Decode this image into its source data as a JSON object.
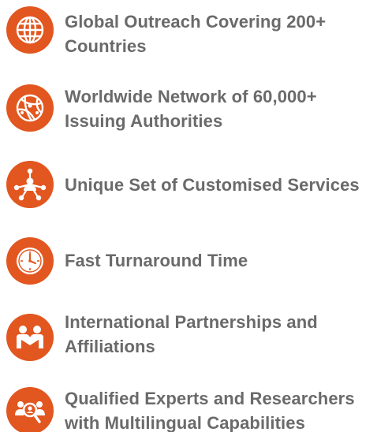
{
  "features": [
    {
      "icon": "globe-icon",
      "lines": [
        "Global Outreach Covering 200+",
        "Countries"
      ]
    },
    {
      "icon": "network-globe-icon",
      "lines": [
        "Worldwide Network of 60,000+",
        "Issuing Authorities"
      ]
    },
    {
      "icon": "customer-hub-icon",
      "lines": [
        "Unique Set of Customised Services"
      ]
    },
    {
      "icon": "clock-icon",
      "lines": [
        "Fast Turnaround Time"
      ]
    },
    {
      "icon": "partners-icon",
      "lines": [
        "International Partnerships and",
        "Affiliations"
      ]
    },
    {
      "icon": "experts-search-icon",
      "lines": [
        "Qualified Experts and Researchers",
        "with Multilingual Capabilities"
      ]
    }
  ],
  "colors": {
    "accent": "#e2561f",
    "text": "#6a6a6a"
  }
}
